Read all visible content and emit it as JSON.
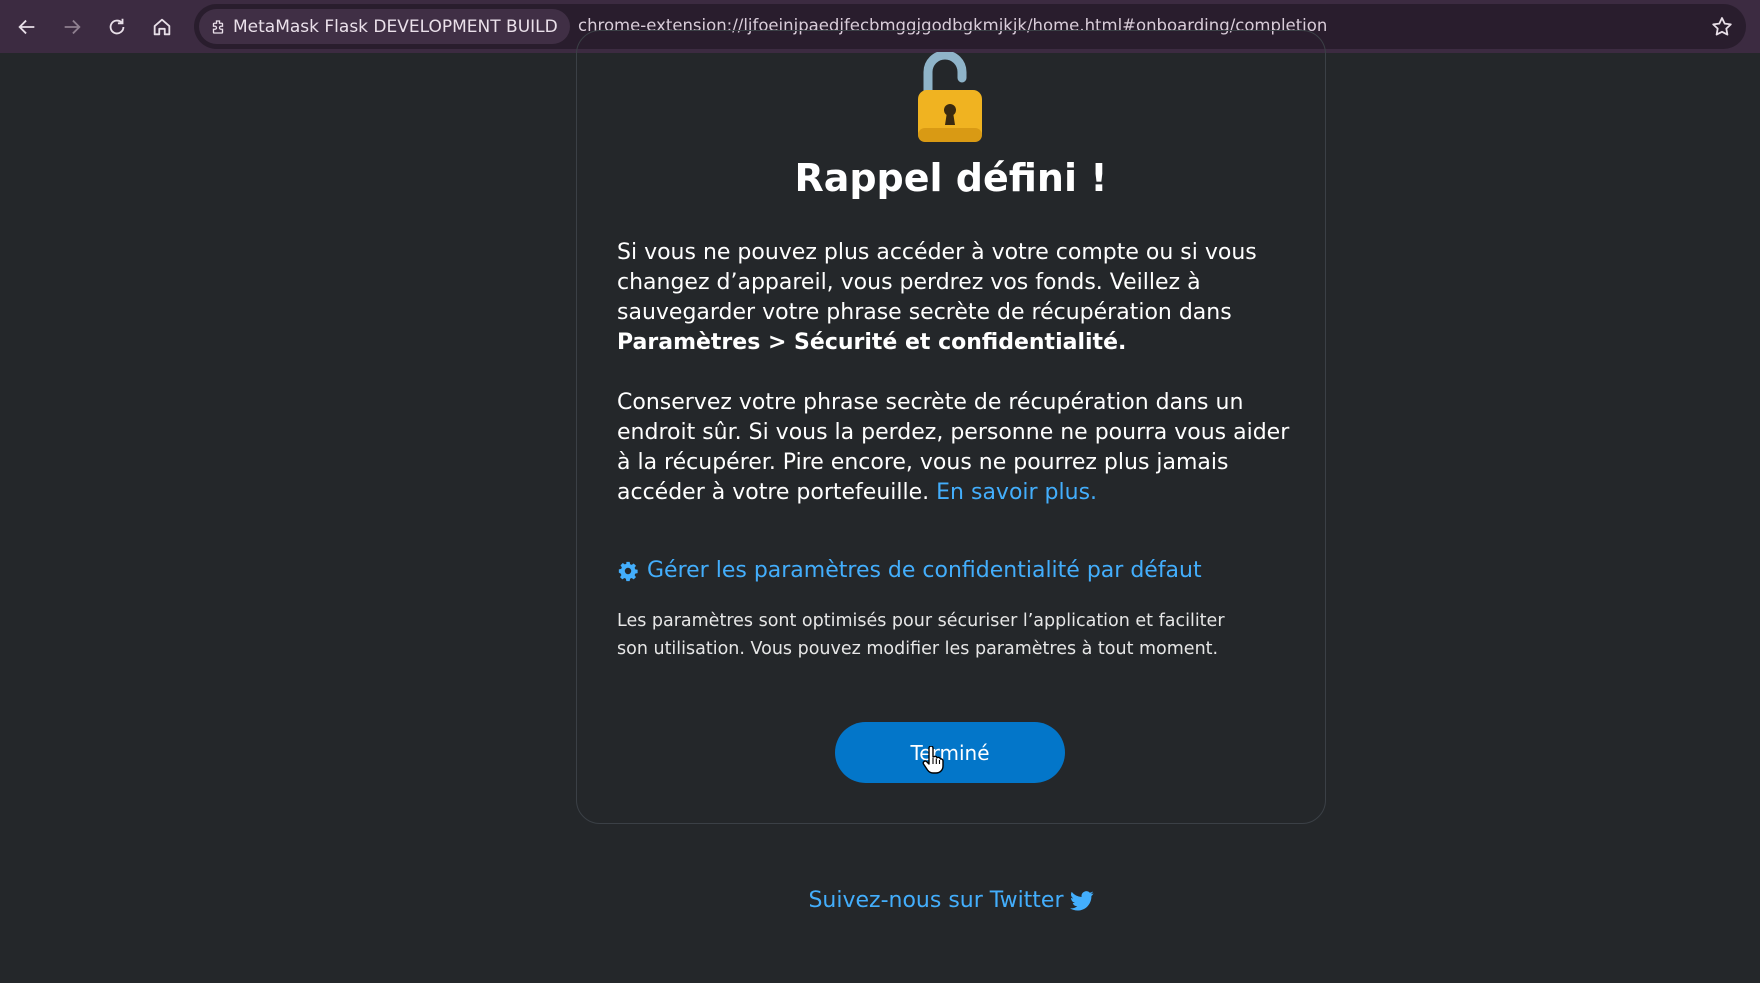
{
  "browser": {
    "site_name": "MetaMask Flask DEVELOPMENT BUILD",
    "url": "chrome-extension://ljfoeinjpaedjfecbmggjgodbgkmjkjk/home.html#onboarding/completion"
  },
  "main": {
    "title": "Rappel défini !",
    "para1_text": "Si vous ne pouvez plus accéder à votre compte ou si vous changez d’appareil, vous perdrez vos fonds. Veillez à sauvegarder votre phrase secrète de récupération dans",
    "para1_bold": "Paramètres > Sécurité et confidentialité.",
    "para2_text": "Conservez votre phrase secrète de récupération dans un endroit sûr. Si vous la perdez, personne ne pourra vous aider à la récupérer. Pire encore, vous ne pourrez plus jamais accéder à votre portefeuille.",
    "learn_more": "En savoir plus.",
    "settings_link": "Gérer les paramètres de confidentialité par défaut",
    "settings_desc": "Les paramètres sont optimisés pour sécuriser l’application et faciliter son utilisation. Vous pouvez modifier les paramètres à tout moment.",
    "done_button": "Terminé",
    "twitter_link": "Suivez-nous sur Twitter"
  },
  "colors": {
    "background": "#24272a",
    "accent_link": "#43aefc",
    "primary_button": "#0376c9",
    "toolbar": "#3c2b41"
  }
}
